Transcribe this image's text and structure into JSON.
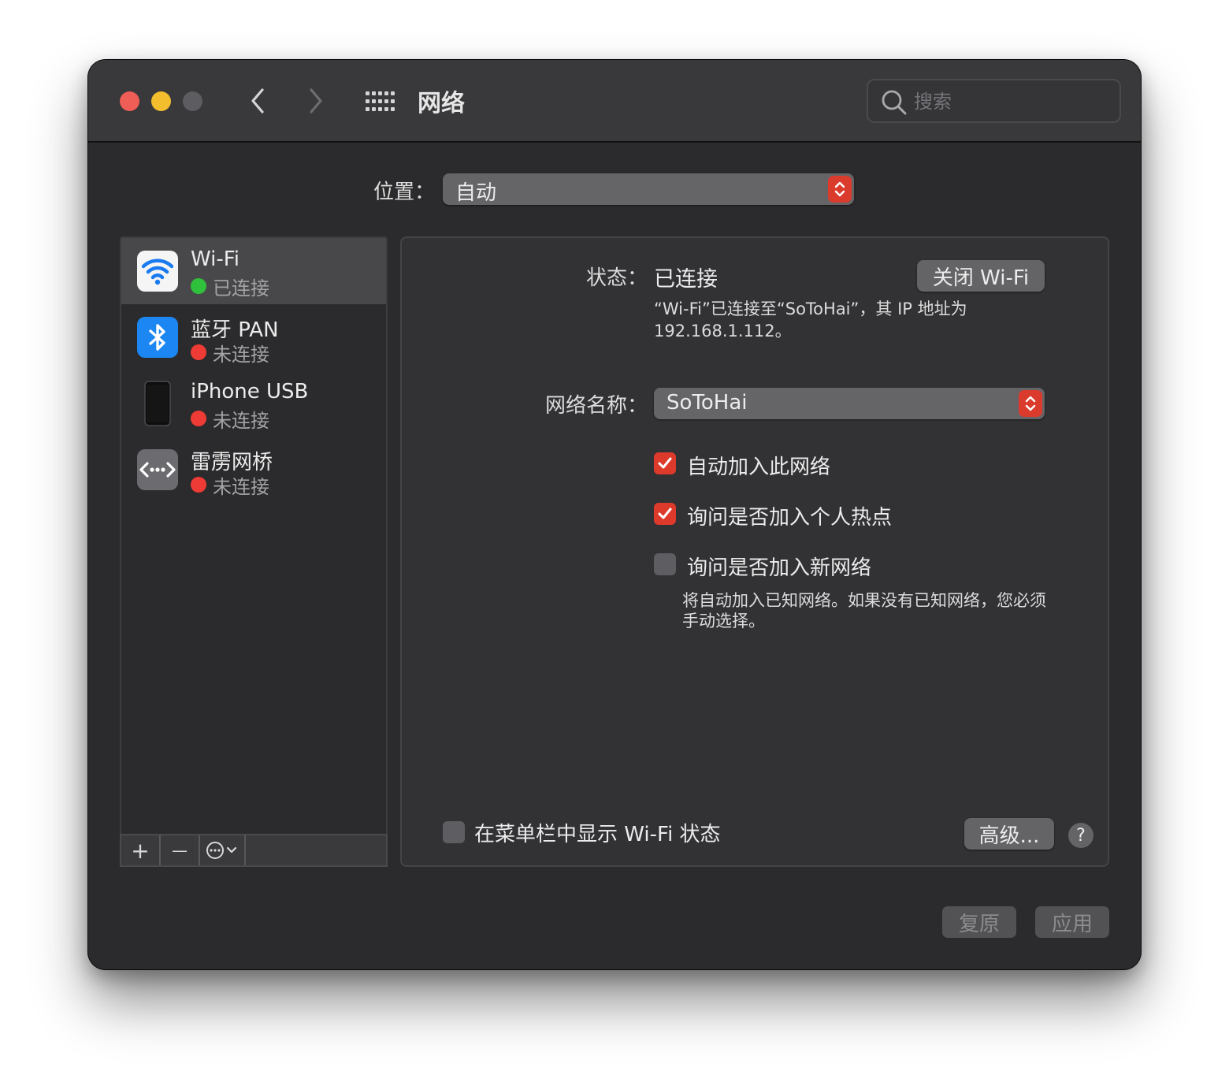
{
  "window": {
    "title": "网络",
    "search_placeholder": "搜索"
  },
  "location": {
    "label": "位置：",
    "value": "自动"
  },
  "services": [
    {
      "name": "Wi-Fi",
      "status": "已连接",
      "status_color": "#30c13c",
      "icon": "wifi-icon",
      "selected": true
    },
    {
      "name": "蓝牙 PAN",
      "status": "未连接",
      "status_color": "#ee3b36",
      "icon": "bluetooth-icon",
      "selected": false
    },
    {
      "name": "iPhone USB",
      "status": "未连接",
      "status_color": "#ee3b36",
      "icon": "iphone-icon",
      "selected": false
    },
    {
      "name": "雷雳网桥",
      "status": "未连接",
      "status_color": "#ee3b36",
      "icon": "thunderbolt-bridge-icon",
      "selected": false
    }
  ],
  "sidebar_toolbar": {
    "add": "+",
    "remove": "—"
  },
  "detail": {
    "status_label": "状态：",
    "status_value": "已连接",
    "toggle_wifi_button": "关闭 Wi-Fi",
    "status_description_line1": "“Wi-Fi”已连接至“SoToHai”，其 IP 地址为",
    "status_description_line2": "192.168.1.112。",
    "network_name_label": "网络名称：",
    "network_name_value": "SoToHai",
    "options": [
      {
        "label": "自动加入此网络",
        "checked": true
      },
      {
        "label": "询问是否加入个人热点",
        "checked": true
      },
      {
        "label": "询问是否加入新网络",
        "checked": false
      }
    ],
    "new_network_note_line1": "将自动加入已知网络。如果没有已知网络，您必须",
    "new_network_note_line2": "手动选择。",
    "show_in_menubar_label": "在菜单栏中显示 Wi-Fi 状态",
    "show_in_menubar_checked": false,
    "advanced_button": "高级...",
    "help_button": "?"
  },
  "footer": {
    "revert_button": "复原",
    "apply_button": "应用"
  },
  "colors": {
    "accent": "#dd3a2c",
    "connected": "#30c13c",
    "disconnected": "#ee3b36"
  }
}
